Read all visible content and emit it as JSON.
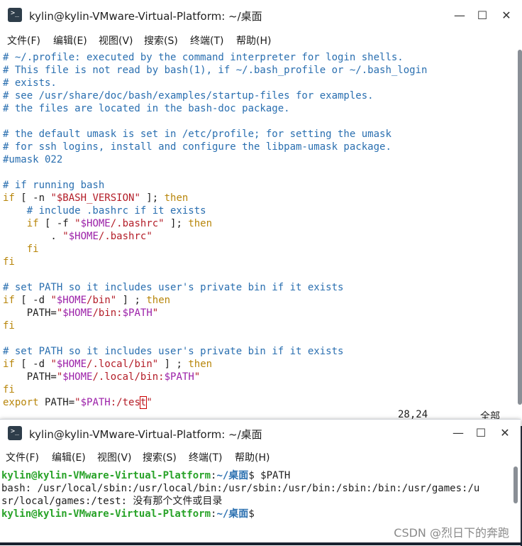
{
  "window1": {
    "title": "kylin@kylin-VMware-Virtual-Platform: ~/桌面",
    "menu": [
      "文件(F)",
      "编辑(E)",
      "视图(V)",
      "搜索(S)",
      "终端(T)",
      "帮助(H)"
    ],
    "lines": [
      [
        [
          "# ~/.profile: executed by the command interpreter for login shells.",
          "cm"
        ]
      ],
      [
        [
          "# This file is not read by bash(1), if ~/.bash_profile or ~/.bash_login",
          "cm"
        ]
      ],
      [
        [
          "# exists.",
          "cm"
        ]
      ],
      [
        [
          "# see /usr/share/doc/bash/examples/startup-files for examples.",
          "cm"
        ]
      ],
      [
        [
          "# the files are located in the bash-doc package.",
          "cm"
        ]
      ],
      [],
      [
        [
          "# the default umask is set in /etc/profile; for setting the umask",
          "cm"
        ]
      ],
      [
        [
          "# for ssh logins, install and configure the libpam-umask package.",
          "cm"
        ]
      ],
      [
        [
          "#umask 022",
          "cm"
        ]
      ],
      [],
      [
        [
          "# if running bash",
          "cm"
        ]
      ],
      [
        [
          "if",
          "kw"
        ],
        [
          " [ -n ",
          "pl"
        ],
        [
          "\"$BASH_VERSION\"",
          "str"
        ],
        [
          " ]; ",
          "pl"
        ],
        [
          "then",
          "kw"
        ]
      ],
      [
        [
          "    ",
          "pl"
        ],
        [
          "# include .bashrc if it exists",
          "cm"
        ]
      ],
      [
        [
          "    ",
          "pl"
        ],
        [
          "if",
          "kw"
        ],
        [
          " [ -f ",
          "pl"
        ],
        [
          "\"",
          "str"
        ],
        [
          "$HOME",
          "var"
        ],
        [
          "/.bashrc\"",
          "str"
        ],
        [
          " ]; ",
          "pl"
        ],
        [
          "then",
          "kw"
        ]
      ],
      [
        [
          "        . ",
          "pl"
        ],
        [
          "\"",
          "str"
        ],
        [
          "$HOME",
          "var"
        ],
        [
          "/.bashrc\"",
          "str"
        ]
      ],
      [
        [
          "    ",
          "pl"
        ],
        [
          "fi",
          "kw"
        ]
      ],
      [
        [
          "fi",
          "kw"
        ]
      ],
      [],
      [
        [
          "# set PATH so it includes user's private bin if it exists",
          "cm"
        ]
      ],
      [
        [
          "if",
          "kw"
        ],
        [
          " [ -d ",
          "pl"
        ],
        [
          "\"",
          "str"
        ],
        [
          "$HOME",
          "var"
        ],
        [
          "/bin\"",
          "str"
        ],
        [
          " ] ; ",
          "pl"
        ],
        [
          "then",
          "kw"
        ]
      ],
      [
        [
          "    PATH=",
          "pl"
        ],
        [
          "\"",
          "str"
        ],
        [
          "$HOME",
          "var"
        ],
        [
          "/bin:",
          "str"
        ],
        [
          "$PATH",
          "var"
        ],
        [
          "\"",
          "str"
        ]
      ],
      [
        [
          "fi",
          "kw"
        ]
      ],
      [],
      [
        [
          "# set PATH so it includes user's private bin if it exists",
          "cm"
        ]
      ],
      [
        [
          "if",
          "kw"
        ],
        [
          " [ -d ",
          "pl"
        ],
        [
          "\"",
          "str"
        ],
        [
          "$HOME",
          "var"
        ],
        [
          "/.local/bin\"",
          "str"
        ],
        [
          " ] ; ",
          "pl"
        ],
        [
          "then",
          "kw"
        ]
      ],
      [
        [
          "    PATH=",
          "pl"
        ],
        [
          "\"",
          "str"
        ],
        [
          "$HOME",
          "var"
        ],
        [
          "/.local/bin:",
          "str"
        ],
        [
          "$PATH",
          "var"
        ],
        [
          "\"",
          "str"
        ]
      ],
      [
        [
          "fi",
          "kw"
        ]
      ],
      [
        [
          "export",
          "kw"
        ],
        [
          " PATH=",
          "pl"
        ],
        [
          "\"",
          "str"
        ],
        [
          "$PATH",
          "var"
        ],
        [
          ":/tes",
          "str"
        ],
        [
          "t",
          "cur"
        ],
        [
          "\"",
          "str"
        ]
      ]
    ],
    "status_pos": "28,24",
    "status_scope": "全部"
  },
  "window2": {
    "title": "kylin@kylin-VMware-Virtual-Platform: ~/桌面",
    "menu": [
      "文件(F)",
      "编辑(E)",
      "视图(V)",
      "搜索(S)",
      "终端(T)",
      "帮助(H)"
    ],
    "prompt_user": "kylin@kylin-VMware-Virtual-Platform",
    "prompt_path": "~/桌面",
    "command1": "$PATH",
    "output": [
      "bash: /usr/local/sbin:/usr/local/bin:/usr/sbin:/usr/bin:/sbin:/bin:/usr/games:/u",
      "sr/local/games:/test: 没有那个文件或目录"
    ],
    "command2": ""
  },
  "watermark": "CSDN @烈日下的奔跑",
  "colors": {
    "comment": "#2a6fb0",
    "keyword": "#b8860b",
    "string": "#b31d28",
    "variable": "#9b1fa8",
    "prompt_user": "#29a329",
    "prompt_path": "#2a6fb0",
    "cursor": "#cc0000"
  }
}
